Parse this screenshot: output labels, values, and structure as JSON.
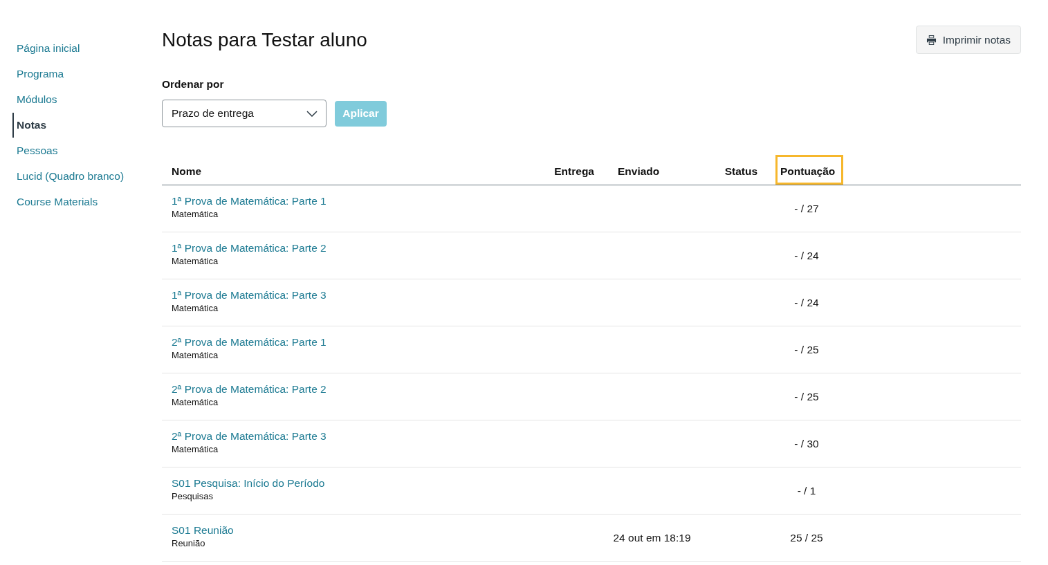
{
  "sidebar": {
    "items": [
      {
        "label": "Página inicial",
        "selected": false
      },
      {
        "label": "Programa",
        "selected": false
      },
      {
        "label": "Módulos",
        "selected": false
      },
      {
        "label": "Notas",
        "selected": true
      },
      {
        "label": "Pessoas",
        "selected": false
      },
      {
        "label": "Lucid (Quadro branco)",
        "selected": false
      },
      {
        "label": "Course Materials",
        "selected": false
      }
    ]
  },
  "header": {
    "title": "Notas para Testar aluno",
    "print_button": "Imprimir notas"
  },
  "sort": {
    "label": "Ordenar por",
    "value": "Prazo de entrega",
    "apply_button": {
      "label": "Aplicar",
      "disabled": true
    }
  },
  "table": {
    "columns": [
      {
        "label": "Nome",
        "highlighted": false
      },
      {
        "label": "Entrega",
        "highlighted": false
      },
      {
        "label": "Enviado",
        "highlighted": false
      },
      {
        "label": "Status",
        "highlighted": false
      },
      {
        "label": "Pontuação",
        "highlighted": true
      }
    ],
    "rows": [
      {
        "name": "1ª Prova de Matemática: Parte 1",
        "category": "Matemática",
        "score": "- / 27"
      },
      {
        "name": "1ª Prova de Matemática: Parte 2",
        "category": "Matemática",
        "score": "- / 24"
      },
      {
        "name": "1ª Prova de Matemática: Parte 3",
        "category": "Matemática",
        "score": "- / 24"
      },
      {
        "name": "2ª Prova de Matemática: Parte 1",
        "category": "Matemática",
        "score": "- / 25"
      },
      {
        "name": "2ª Prova de Matemática: Parte 2",
        "category": "Matemática",
        "score": "- / 25"
      },
      {
        "name": "2ª Prova de Matemática: Parte 3",
        "category": "Matemática",
        "score": "- / 30"
      },
      {
        "name": "S01 Pesquisa: Início do Período",
        "category": "Pesquisas",
        "score": "- / 1"
      },
      {
        "name": "S01 Reunião",
        "category": "Reunião",
        "submitted": "24 out em 18:19",
        "score": "25 / 25"
      }
    ]
  }
}
